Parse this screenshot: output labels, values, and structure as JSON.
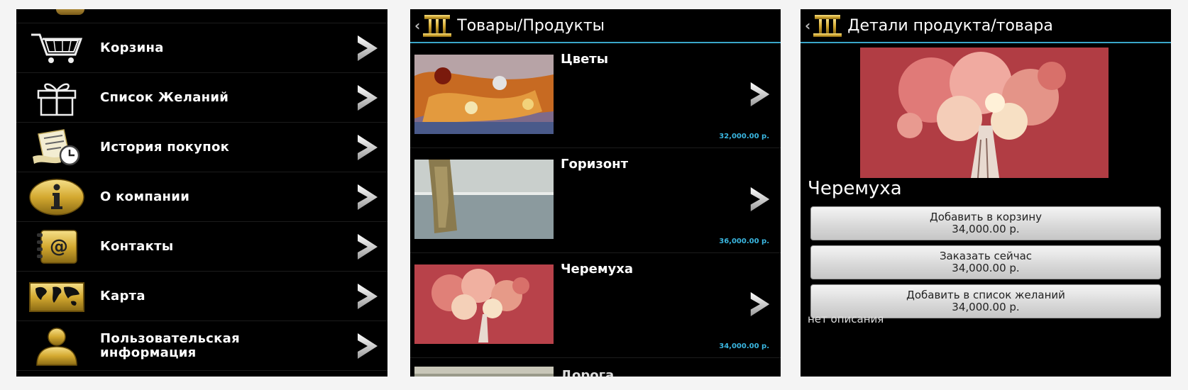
{
  "menu": {
    "items": [
      {
        "label": "Корзина",
        "icon": "cart-icon"
      },
      {
        "label": "Список Желаний",
        "icon": "gift-icon"
      },
      {
        "label": "История покупок",
        "icon": "history-clock-icon"
      },
      {
        "label": "О компании",
        "icon": "info-icon"
      },
      {
        "label": "Контакты",
        "icon": "contacts-at-icon"
      },
      {
        "label": "Карта",
        "icon": "world-map-icon"
      },
      {
        "label": "Пользовательская информация",
        "label_line1": "Пользовательская",
        "label_line2": "информация",
        "icon": "user-icon"
      }
    ]
  },
  "products_screen": {
    "back": "‹",
    "title": "Товары/Продукты",
    "products": [
      {
        "name": "Цветы",
        "price": "32,000.00 р."
      },
      {
        "name": "Горизонт",
        "price": "36,000.00 р."
      },
      {
        "name": "Черемуха",
        "price": "34,000.00 р."
      },
      {
        "name": "Дорога"
      }
    ]
  },
  "details_screen": {
    "back": "‹",
    "title": "Детали продукта/товара",
    "product_name": "Черемуха",
    "buttons": [
      {
        "label": "Добавить в корзину",
        "price": "34,000.00 р."
      },
      {
        "label": "Заказать сейчас",
        "price": "34,000.00 р."
      },
      {
        "label": "Добавить в список желаний",
        "price": "34,000.00 р."
      }
    ],
    "description": "нет описания"
  },
  "colors": {
    "accent_line": "#3aa6c9",
    "price_text": "#3ab6e0",
    "icon_gold": "#d4af37",
    "background": "#000000"
  }
}
